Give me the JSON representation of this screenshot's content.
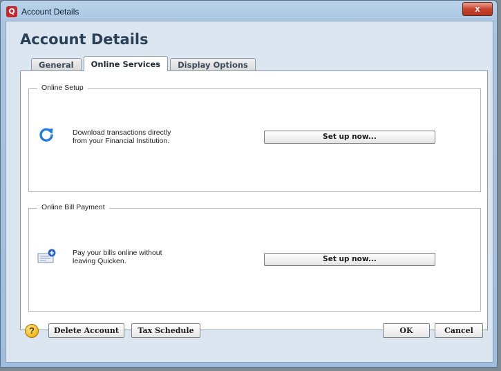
{
  "window": {
    "title": "Account Details",
    "app_icon": "quicken-q-icon",
    "app_icon_glyph": "Q",
    "close_glyph": "x"
  },
  "header": {
    "title": "Account Details"
  },
  "tabs": [
    {
      "label": "General",
      "active": false
    },
    {
      "label": "Online Services",
      "active": true
    },
    {
      "label": "Display Options",
      "active": false
    }
  ],
  "online_setup": {
    "legend": "Online Setup",
    "icon": "refresh-icon",
    "description_line1": "Download transactions directly",
    "description_line2": "from your Financial Institution.",
    "button_label": "Set up now..."
  },
  "bill_payment": {
    "legend": "Online Bill Payment",
    "icon": "bill-pay-icon",
    "description_line1": "Pay your bills online without",
    "description_line2": "leaving Quicken.",
    "button_label": "Set up now..."
  },
  "footer": {
    "help_glyph": "?",
    "delete_label": "Delete Account",
    "tax_label": "Tax Schedule",
    "ok_label": "OK",
    "cancel_label": "Cancel"
  },
  "colors": {
    "accent": "#1f7be0",
    "close_button": "#c8432e",
    "title_text": "#2b3f55"
  }
}
